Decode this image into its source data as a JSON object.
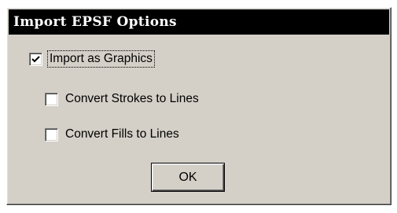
{
  "dialog": {
    "title": "Import EPSF Options",
    "options": [
      {
        "label": "Import as Graphics",
        "checked": true,
        "focused": true
      },
      {
        "label": "Convert Strokes to Lines",
        "checked": false
      },
      {
        "label": "Convert Fills to Lines",
        "checked": false
      }
    ],
    "ok_label": "OK"
  },
  "colors": {
    "dialog_face": "#d4d0c8",
    "title_bar": "#000000",
    "title_text": "#ffffff"
  }
}
